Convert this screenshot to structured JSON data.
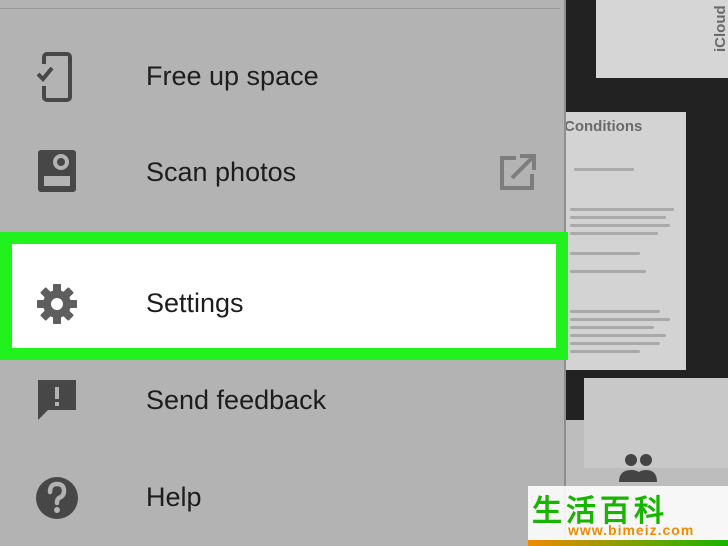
{
  "menu": {
    "items": [
      {
        "id": "free-up-space",
        "label": "Free up space",
        "icon": "phone-check-icon"
      },
      {
        "id": "scan-photos",
        "label": "Scan photos",
        "icon": "photo-scan-icon",
        "trailing_icon": "open-external-icon"
      },
      {
        "id": "settings",
        "label": "Settings",
        "icon": "gear-icon",
        "highlighted": true
      },
      {
        "id": "send-feedback",
        "label": "Send feedback",
        "icon": "feedback-icon"
      },
      {
        "id": "help",
        "label": "Help",
        "icon": "help-icon"
      }
    ],
    "highlight_color": "#21f21d"
  },
  "background": {
    "texts": [
      "iCloud",
      "Conditions"
    ]
  },
  "watermark": {
    "chars": "生活百科",
    "url": "www.bimeiz.com"
  }
}
